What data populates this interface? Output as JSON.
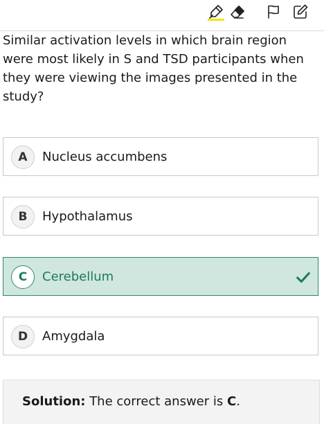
{
  "toolbar": {
    "icons": [
      "highlighter-icon",
      "eraser-icon",
      "flag-icon",
      "note-edit-icon"
    ],
    "highlight_color": "#f2e600"
  },
  "question": {
    "text": "Similar activation levels in which brain region were most likely in S and TSD participants when they were viewing the images presented in the study?"
  },
  "options": [
    {
      "letter": "A",
      "text": "Nucleus accumbens",
      "selected": false
    },
    {
      "letter": "B",
      "text": "Hypothalamus",
      "selected": false
    },
    {
      "letter": "C",
      "text": "Cerebellum",
      "selected": true
    },
    {
      "letter": "D",
      "text": "Amygdala",
      "selected": false
    }
  ],
  "solution": {
    "label": "Solution:",
    "text": " The correct answer is ",
    "answer": "C",
    "suffix": "."
  },
  "colors": {
    "selected_bg": "#cfe7df",
    "selected_border": "#2f8a65",
    "selected_text": "#1f7a55"
  }
}
